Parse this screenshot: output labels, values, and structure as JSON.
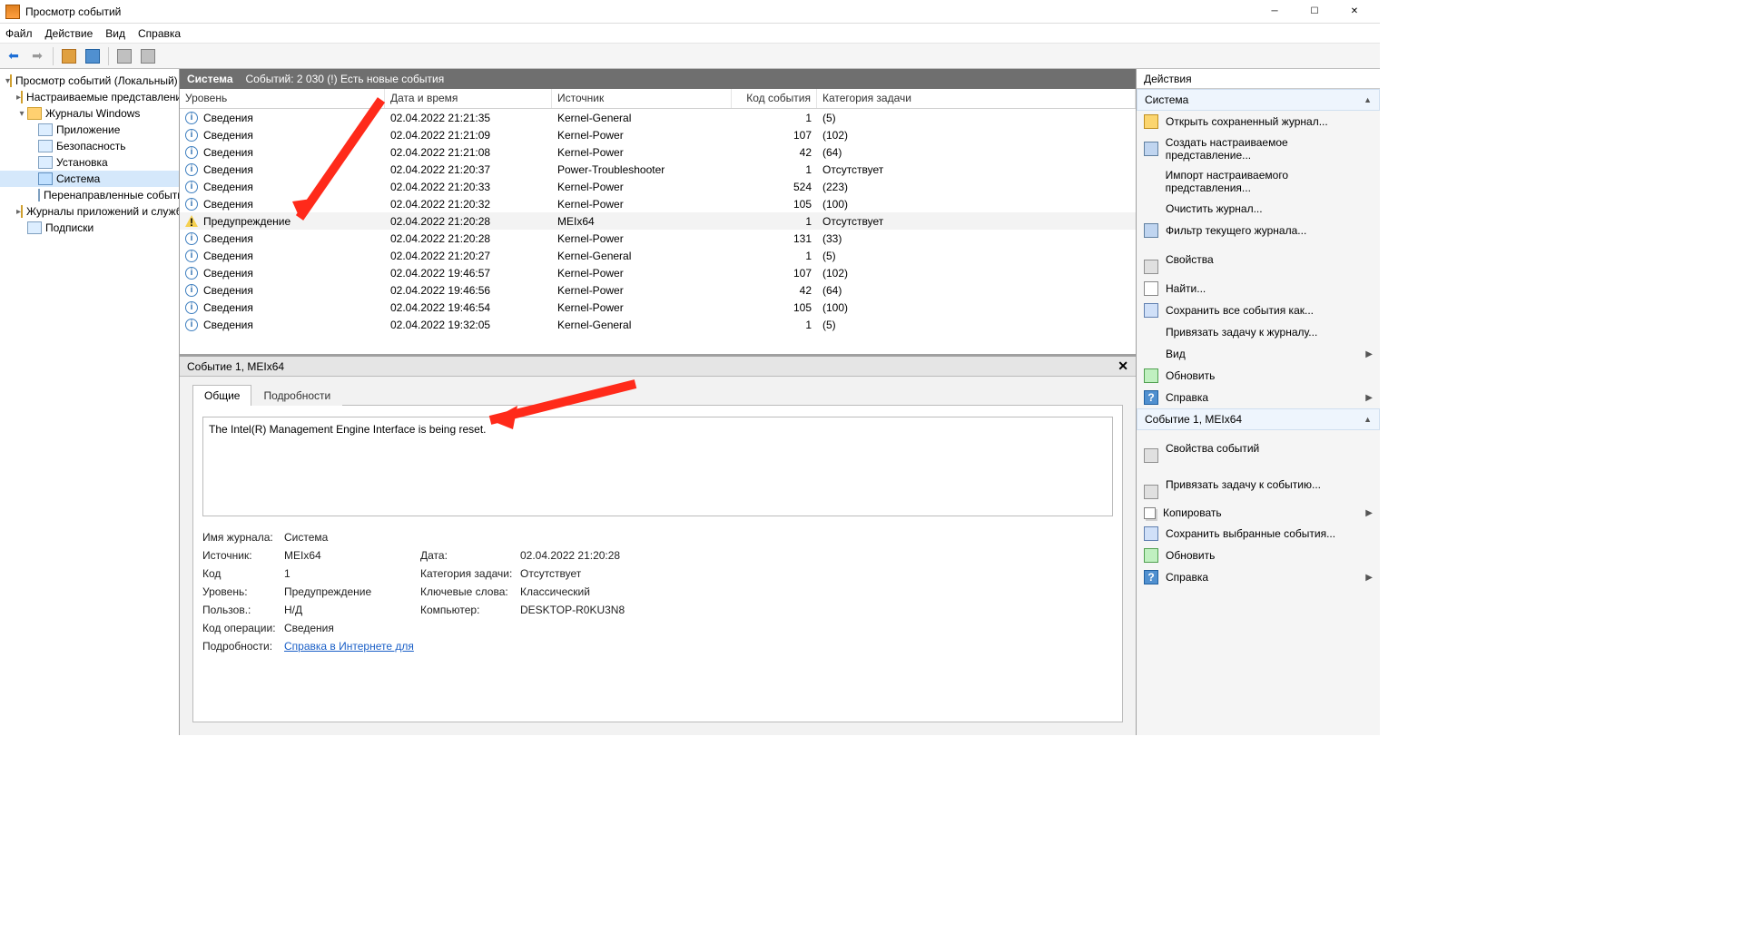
{
  "window": {
    "title": "Просмотр событий"
  },
  "menu": {
    "file": "Файл",
    "action": "Действие",
    "view": "Вид",
    "help": "Справка"
  },
  "tree": {
    "root": "Просмотр событий (Локальный)",
    "custom": "Настраиваемые представления",
    "winlogs": "Журналы Windows",
    "app": "Приложение",
    "security": "Безопасность",
    "setup": "Установка",
    "system": "Система",
    "forwarded": "Перенаправленные события",
    "appsvclogs": "Журналы приложений и служб",
    "subs": "Подписки"
  },
  "header": {
    "name": "Система",
    "count": "Событий: 2 030 (!) Есть новые события"
  },
  "cols": {
    "level": "Уровень",
    "date": "Дата и время",
    "source": "Источник",
    "code": "Код события",
    "cat": "Категория задачи"
  },
  "lvl": {
    "info": "Сведения",
    "warn": "Предупреждение"
  },
  "rows": [
    {
      "l": "info",
      "d": "02.04.2022 21:21:35",
      "s": "Kernel-General",
      "c": "1",
      "t": "(5)"
    },
    {
      "l": "info",
      "d": "02.04.2022 21:21:09",
      "s": "Kernel-Power",
      "c": "107",
      "t": "(102)"
    },
    {
      "l": "info",
      "d": "02.04.2022 21:21:08",
      "s": "Kernel-Power",
      "c": "42",
      "t": "(64)"
    },
    {
      "l": "info",
      "d": "02.04.2022 21:20:37",
      "s": "Power-Troubleshooter",
      "c": "1",
      "t": "Отсутствует"
    },
    {
      "l": "info",
      "d": "02.04.2022 21:20:33",
      "s": "Kernel-Power",
      "c": "524",
      "t": "(223)"
    },
    {
      "l": "info",
      "d": "02.04.2022 21:20:32",
      "s": "Kernel-Power",
      "c": "105",
      "t": "(100)"
    },
    {
      "l": "warn",
      "d": "02.04.2022 21:20:28",
      "s": "MEIx64",
      "c": "1",
      "t": "Отсутствует",
      "sel": true
    },
    {
      "l": "info",
      "d": "02.04.2022 21:20:28",
      "s": "Kernel-Power",
      "c": "131",
      "t": "(33)"
    },
    {
      "l": "info",
      "d": "02.04.2022 21:20:27",
      "s": "Kernel-General",
      "c": "1",
      "t": "(5)"
    },
    {
      "l": "info",
      "d": "02.04.2022 19:46:57",
      "s": "Kernel-Power",
      "c": "107",
      "t": "(102)"
    },
    {
      "l": "info",
      "d": "02.04.2022 19:46:56",
      "s": "Kernel-Power",
      "c": "42",
      "t": "(64)"
    },
    {
      "l": "info",
      "d": "02.04.2022 19:46:54",
      "s": "Kernel-Power",
      "c": "105",
      "t": "(100)"
    },
    {
      "l": "info",
      "d": "02.04.2022 19:32:05",
      "s": "Kernel-General",
      "c": "1",
      "t": "(5)"
    }
  ],
  "detail": {
    "title": "Событие 1, MEIx64",
    "tabs": {
      "general": "Общие",
      "details": "Подробности"
    },
    "message": "The Intel(R) Management Engine Interface is being reset.",
    "labels": {
      "log": "Имя журнала:",
      "source": "Источник:",
      "code": "Код",
      "cat": "Категория задачи:",
      "level": "Уровень:",
      "keywords": "Ключевые слова:",
      "user": "Пользов.:",
      "computer": "Компьютер:",
      "opcode": "Код операции:",
      "more": "Подробности:",
      "date": "Дата:"
    },
    "values": {
      "log": "Система",
      "source": "MEIx64",
      "code": "1",
      "cat": "Отсутствует",
      "level": "Предупреждение",
      "keywords": "Классический",
      "user": "Н/Д",
      "computer": "DESKTOP-R0KU3N8",
      "opcode": "Сведения",
      "more": "Справка в Интернете для",
      "date": "02.04.2022 21:20:28"
    }
  },
  "actions": {
    "title": "Действия",
    "section1": "Система",
    "open": "Открыть сохраненный журнал...",
    "createView": "Создать настраиваемое представление...",
    "importView": "Импорт настраиваемого представления...",
    "clear": "Очистить журнал...",
    "filter": "Фильтр текущего журнала...",
    "props": "Свойства",
    "find": "Найти...",
    "saveAll": "Сохранить все события как...",
    "attach": "Привязать задачу к журналу...",
    "view": "Вид",
    "refresh": "Обновить",
    "help": "Справка",
    "section2": "Событие 1, MEIx64",
    "evtprops": "Свойства событий",
    "attachEvt": "Привязать задачу к событию...",
    "copy": "Копировать",
    "saveSel": "Сохранить выбранные события...",
    "refresh2": "Обновить",
    "help2": "Справка"
  }
}
